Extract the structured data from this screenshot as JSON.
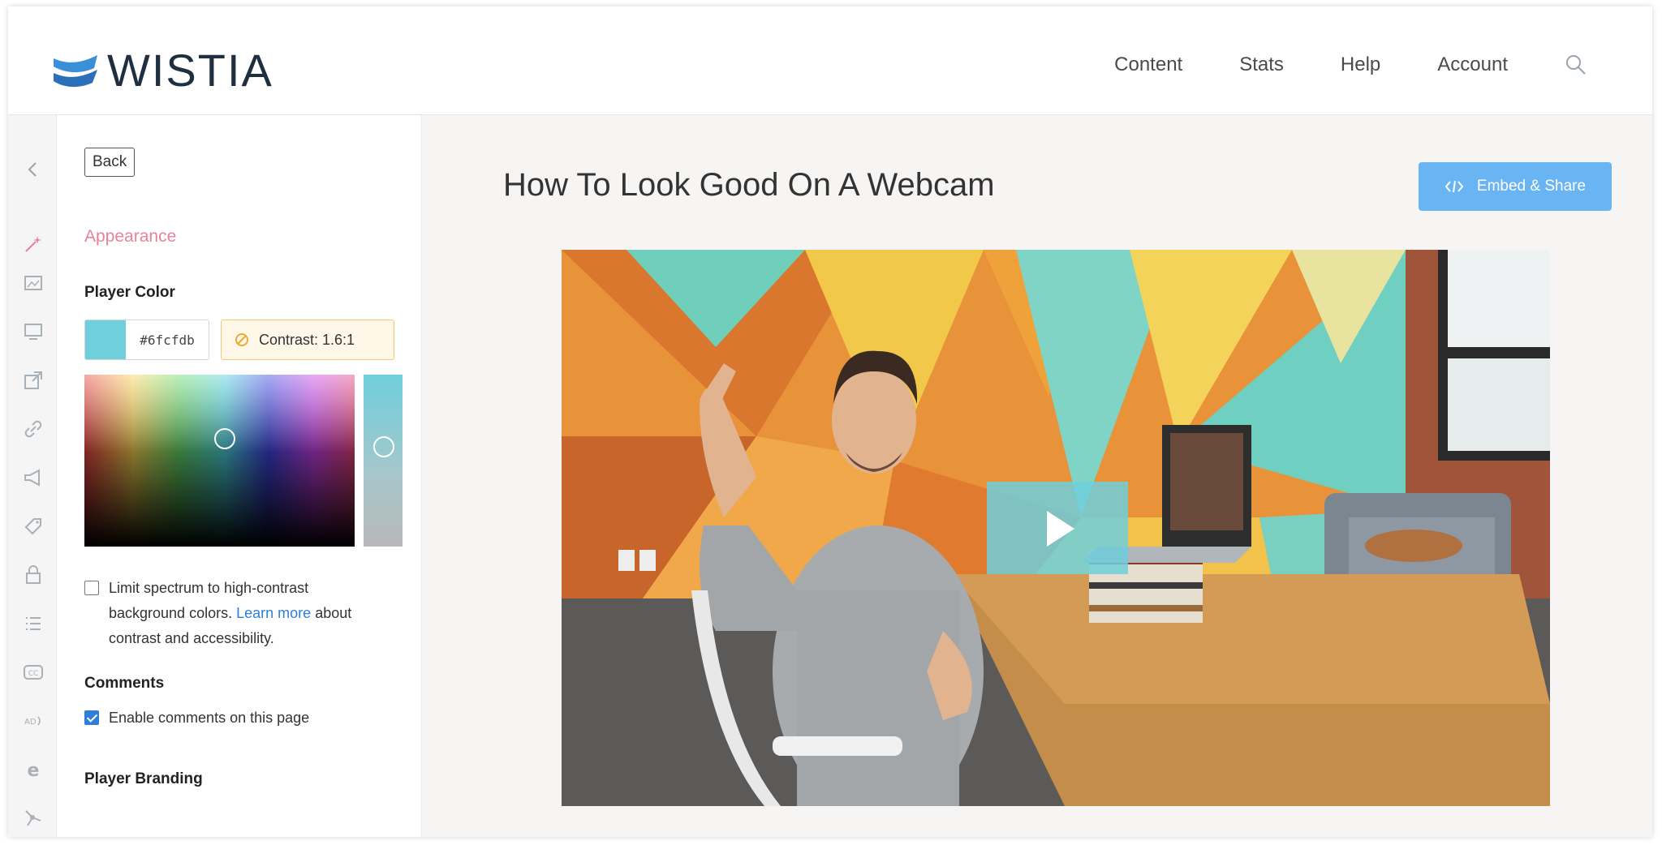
{
  "brand": {
    "name": "WISTIA"
  },
  "nav": {
    "items": [
      "Content",
      "Stats",
      "Help",
      "Account"
    ]
  },
  "panel": {
    "back_label": "Back",
    "section_title": "Appearance",
    "player_color_label": "Player Color",
    "color_hex": "#6fcfdb",
    "contrast_label": "Contrast: 1.6:1",
    "limit_text": "Limit spectrum to high-contrast",
    "limit_text_2": "background colors.",
    "learn_more": "Learn more",
    "about_text": "about",
    "limit_text_3": "contrast and accessibility.",
    "limit_checked": false,
    "comments_label": "Comments",
    "comments_checkbox": "Enable comments on this page",
    "comments_checked": true,
    "branding_label": "Player Branding"
  },
  "main": {
    "title": "How To Look Good On A Webcam",
    "embed_label": "Embed & Share"
  },
  "colors": {
    "player": "#6fcfdb",
    "accent_pink": "#e8829a",
    "embed_blue": "#69b4f3"
  }
}
